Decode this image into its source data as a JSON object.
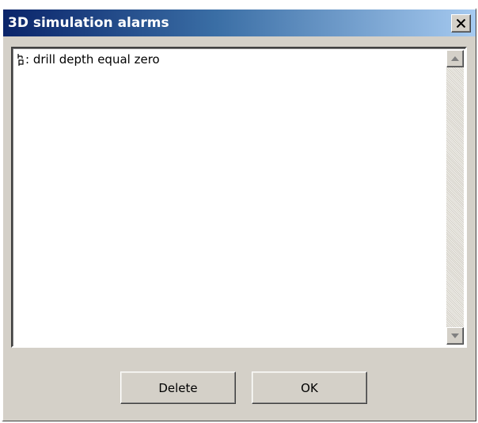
{
  "window": {
    "title": "3D simulation alarms"
  },
  "titlebar": {
    "close_icon": "close-icon",
    "colors": {
      "gradient_start": "#0a246a",
      "gradient_end": "#a6caf0"
    }
  },
  "alarms": {
    "items": [
      {
        "icon": "alarm-marker-icon",
        "text": ": drill depth equal zero"
      }
    ]
  },
  "scrollbar": {
    "up_icon": "arrow-up-icon",
    "down_icon": "arrow-down-icon"
  },
  "buttons": {
    "delete_label": "Delete",
    "ok_label": "OK"
  },
  "theme": {
    "face": "#d4d0c8",
    "list_background": "#ffffff"
  }
}
